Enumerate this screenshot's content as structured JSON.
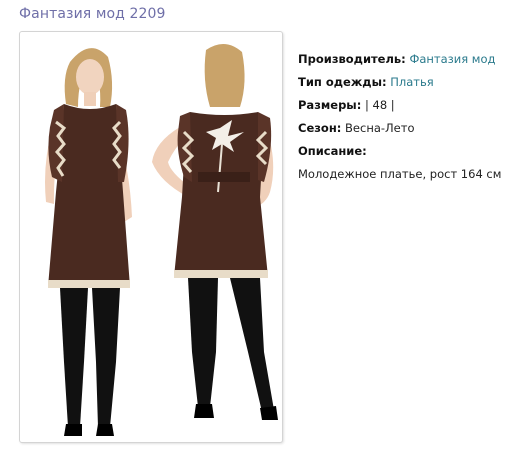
{
  "page": {
    "title": "Фантазия мод 2209"
  },
  "product": {
    "manufacturer_label": "Производитель:",
    "manufacturer_value": "Фантазия мод",
    "type_label": "Тип одежды:",
    "type_value": "Платья",
    "sizes_label": "Размеры:",
    "sizes_value": "| 48 |",
    "season_label": "Сезон:",
    "season_value": "Весна-Лето",
    "description_label": "Описание:",
    "description_value": "Молодежное платье, рост 164 см"
  },
  "colors": {
    "title": "#6f6fa8",
    "link": "#2a7a8c",
    "dress": "#4a2a20",
    "trim": "#e8dcc8"
  },
  "icons": {
    "photo": "product-photo"
  }
}
